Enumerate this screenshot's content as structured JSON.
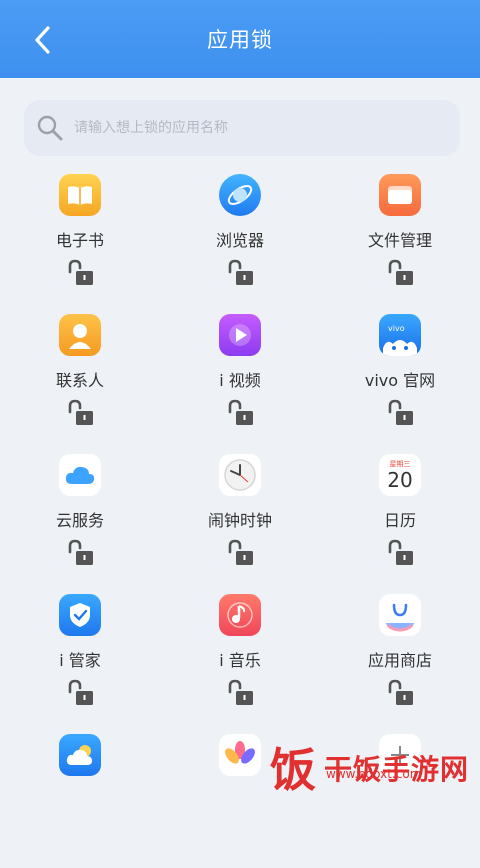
{
  "header": {
    "title": "应用锁"
  },
  "search": {
    "placeholder": "请输入想上锁的应用名称"
  },
  "apps": [
    {
      "name": "电子书",
      "icon": "book-icon"
    },
    {
      "name": "浏览器",
      "icon": "browser-icon"
    },
    {
      "name": "文件管理",
      "icon": "folder-icon"
    },
    {
      "name": "联系人",
      "icon": "contacts-icon"
    },
    {
      "name": "i 视频",
      "icon": "video-icon"
    },
    {
      "name": "vivo 官网",
      "icon": "vivo-store-icon"
    },
    {
      "name": "云服务",
      "icon": "cloud-icon"
    },
    {
      "name": "闹钟时钟",
      "icon": "clock-icon"
    },
    {
      "name": "日历",
      "icon": "calendar-icon",
      "badge": "星期三",
      "day": "20"
    },
    {
      "name": "i 管家",
      "icon": "shield-icon"
    },
    {
      "name": "i 音乐",
      "icon": "music-icon"
    },
    {
      "name": "应用商店",
      "icon": "app-store-icon"
    },
    {
      "name": "",
      "icon": "weather-icon"
    },
    {
      "name": "",
      "icon": "photos-icon"
    },
    {
      "name": "",
      "icon": "more-icon"
    }
  ],
  "watermark": {
    "text": "干饭手游网",
    "url": "www.edoxt.com"
  },
  "colors": {
    "header": "#3e90ef",
    "lock": "#555555",
    "background": "#eef2f7"
  }
}
